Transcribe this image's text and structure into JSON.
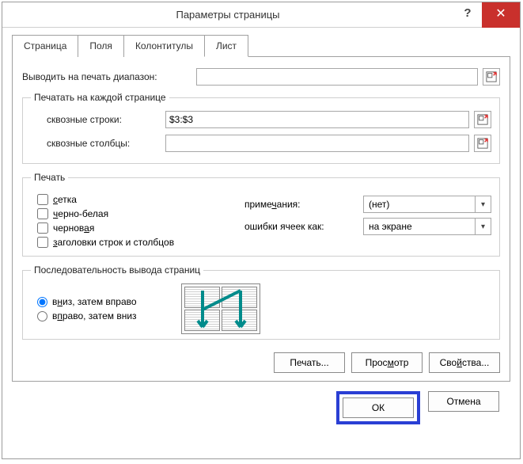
{
  "window": {
    "title": "Параметры страницы",
    "help_symbol": "?",
    "close_symbol": "✕"
  },
  "tabs": {
    "page": "Страница",
    "margins": "Поля",
    "headers": "Колонтитулы",
    "sheet": "Лист"
  },
  "labels": {
    "print_range": "Выводить на печать диапазон:",
    "each_page_group": "Печатать на каждой странице",
    "rows_repeat": "сквозные строки:",
    "cols_repeat": "сквозные столбцы:",
    "print_group": "Печать",
    "gridlines": "сетка",
    "bw": "черно-белая",
    "draft": "черновая",
    "rc_headings": "заголовки строк и столбцов",
    "comments": "примечания:",
    "cell_errors": "ошибки ячеек как:",
    "order_group": "Последовательность вывода страниц",
    "down_then_over": "вниз, затем вправо",
    "over_then_down": "вправо, затем вниз"
  },
  "values": {
    "print_range": "",
    "rows_repeat": "$3:$3",
    "cols_repeat": "",
    "comments_selected": "(нет)",
    "errors_selected": "на экране",
    "gridlines": false,
    "bw": false,
    "draft": false,
    "rc_headings": false,
    "order": "down_then_over"
  },
  "buttons": {
    "print": "Печать...",
    "preview": "Просмотр",
    "options": "Свойства...",
    "ok": "ОК",
    "cancel": "Отмена"
  }
}
